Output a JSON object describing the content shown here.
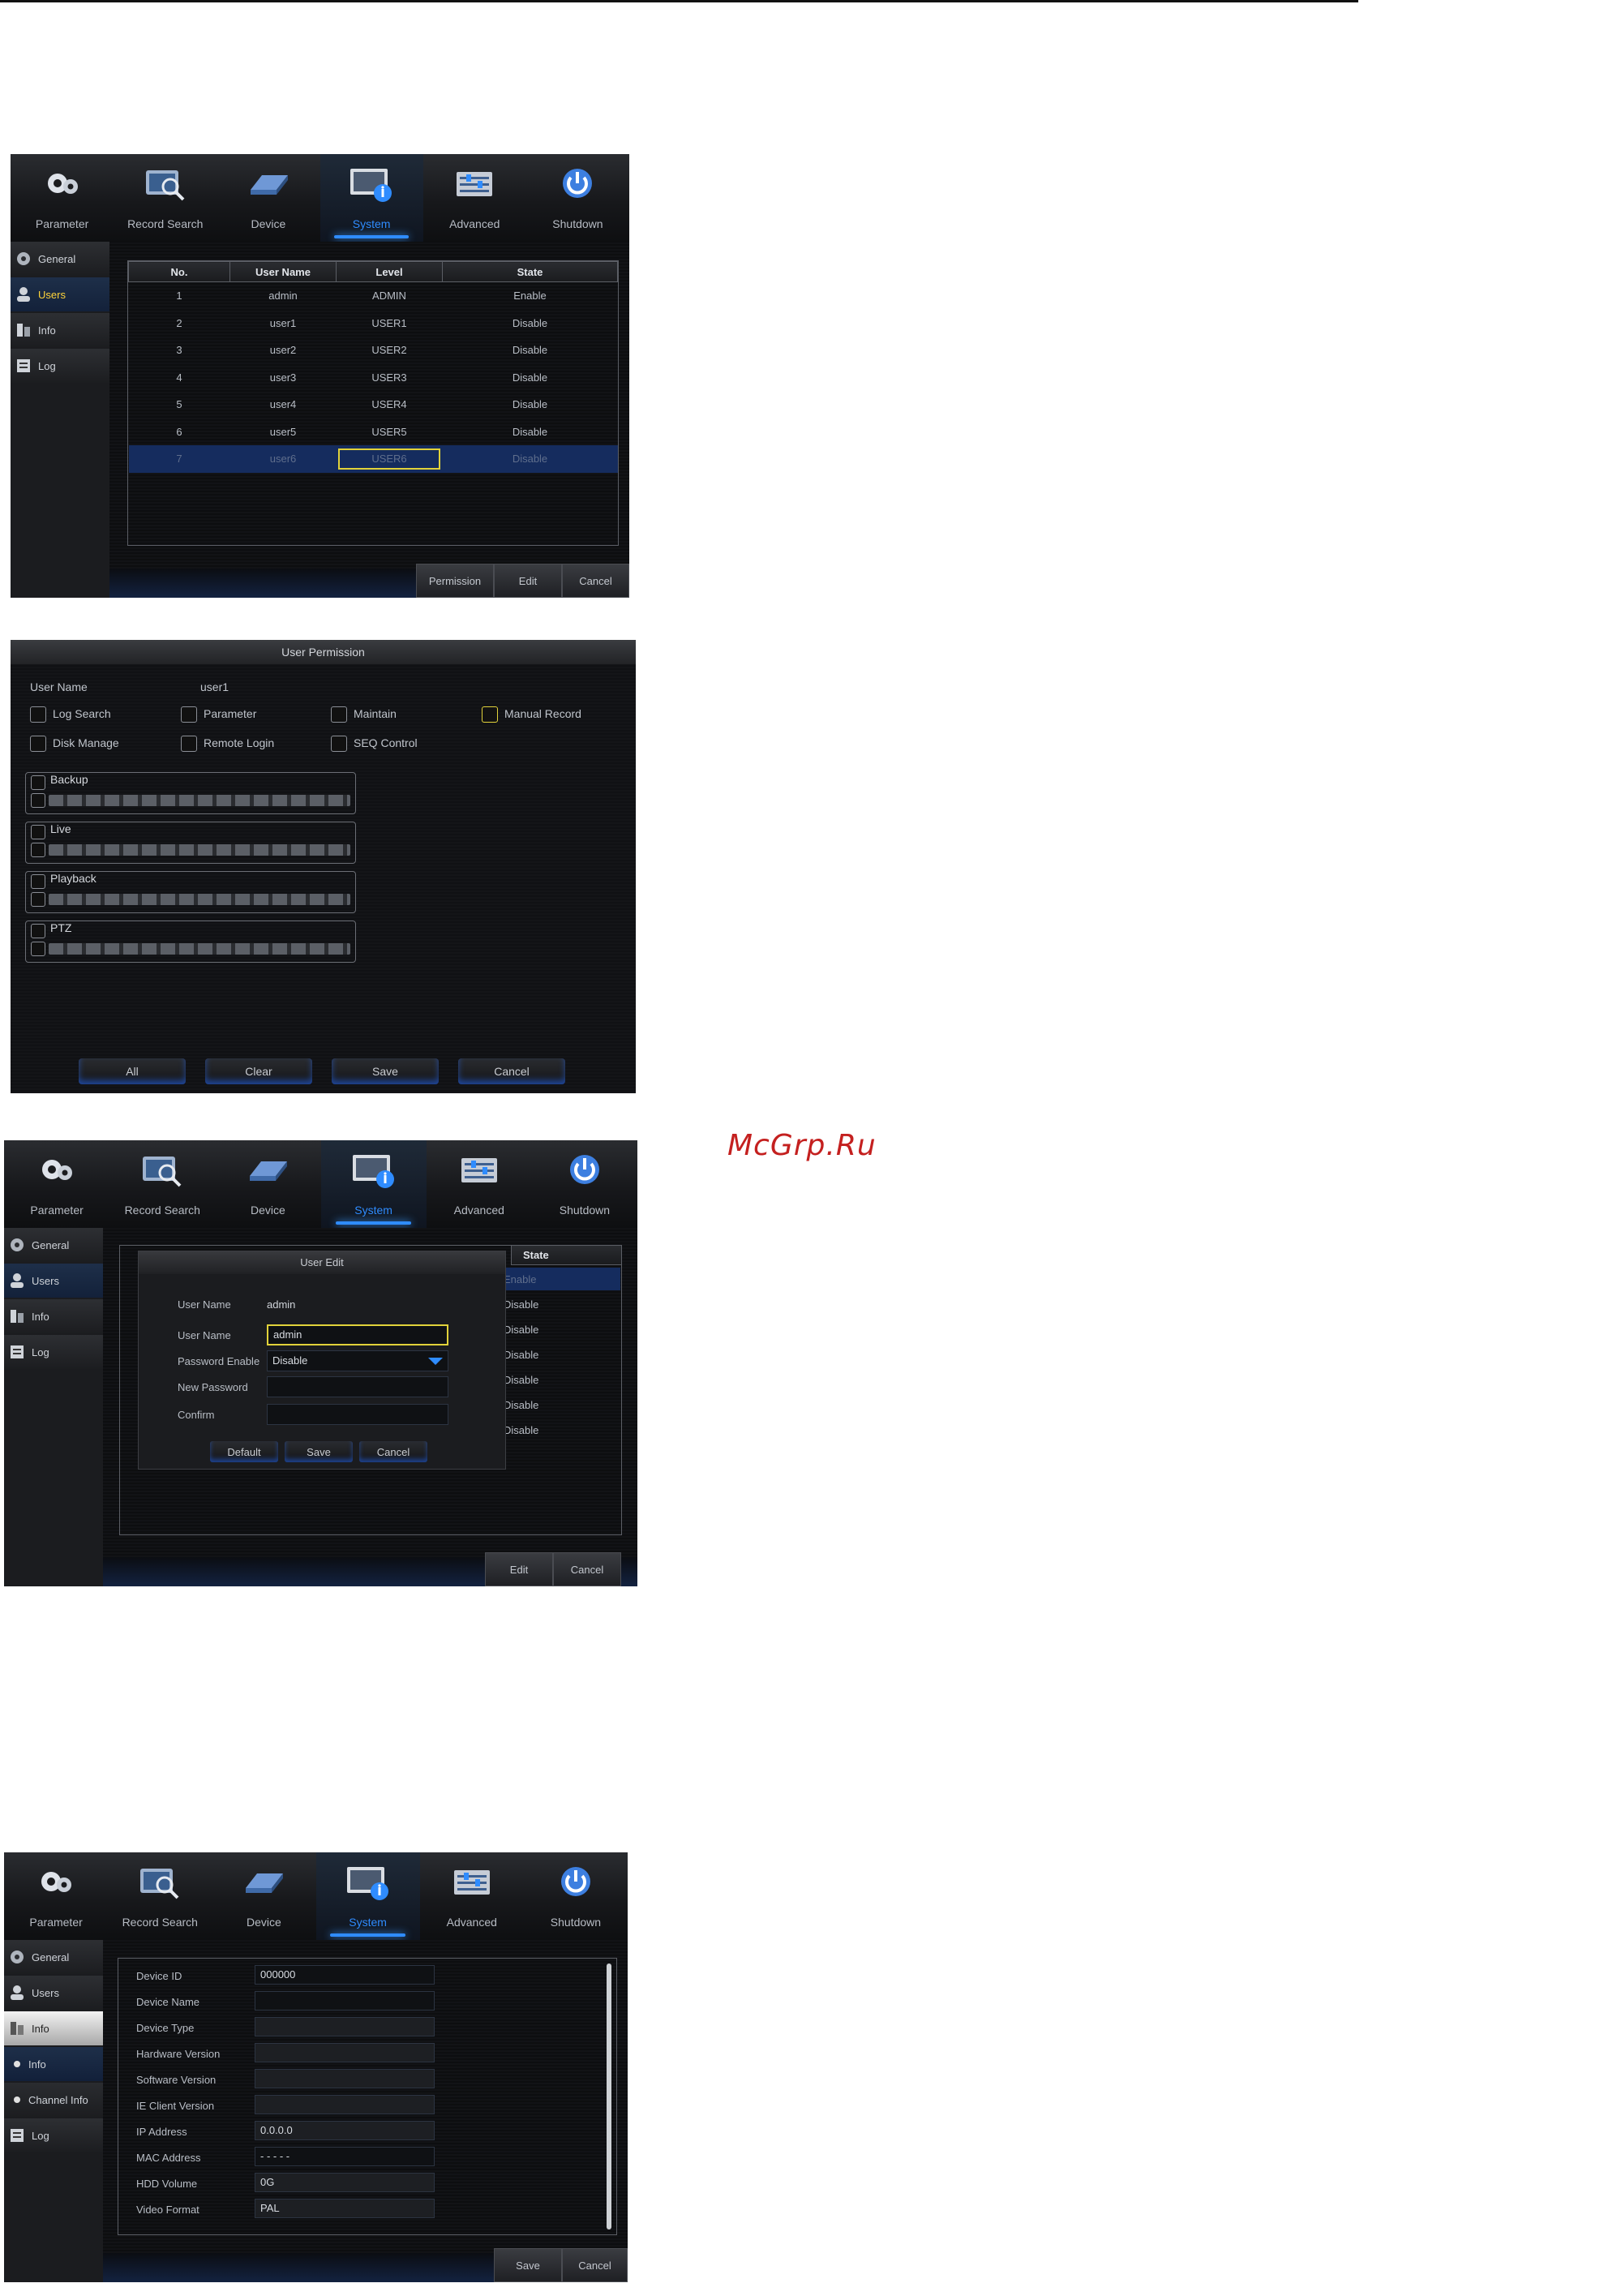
{
  "watermark": "McGrp.Ru",
  "nav": [
    "Parameter",
    "Record Search",
    "Device",
    "System",
    "Advanced",
    "Shutdown"
  ],
  "sidebar": {
    "general": "General",
    "users": "Users",
    "info": "Info",
    "log": "Log",
    "channel_info": "Channel Info"
  },
  "users_table": {
    "headers": [
      "No.",
      "User Name",
      "Level",
      "State"
    ],
    "rows": [
      [
        "1",
        "admin",
        "ADMIN",
        "Enable"
      ],
      [
        "2",
        "user1",
        "USER1",
        "Disable"
      ],
      [
        "3",
        "user2",
        "USER2",
        "Disable"
      ],
      [
        "4",
        "user3",
        "USER3",
        "Disable"
      ],
      [
        "5",
        "user4",
        "USER4",
        "Disable"
      ],
      [
        "6",
        "user5",
        "USER5",
        "Disable"
      ],
      [
        "7",
        "user6",
        "USER6",
        "Disable"
      ]
    ]
  },
  "users_buttons": {
    "permission": "Permission",
    "edit": "Edit",
    "cancel": "Cancel"
  },
  "permission": {
    "title": "User Permission",
    "user_name_label": "User Name",
    "user_name": "user1",
    "options": [
      "Log Search",
      "Parameter",
      "Maintain",
      "Manual Record",
      "Disk Manage",
      "Remote Login",
      "SEQ Control"
    ],
    "groups": [
      "Backup",
      "Live",
      "Playback",
      "PTZ"
    ],
    "buttons": {
      "all": "All",
      "clear": "Clear",
      "save": "Save",
      "cancel": "Cancel"
    }
  },
  "user_edit": {
    "title": "User Edit",
    "state_header": "State",
    "states": [
      "Enable",
      "Disable",
      "Disable",
      "Disable",
      "Disable",
      "Disable",
      "Disable"
    ],
    "labels": {
      "user_name_ro": "User Name",
      "user_name": "User Name",
      "password_enable": "Password Enable",
      "new_password": "New Password",
      "confirm": "Confirm"
    },
    "values": {
      "user_name_ro": "admin",
      "user_name": "admin",
      "password_enable": "Disable",
      "new_password": "",
      "confirm": ""
    },
    "buttons": {
      "default": "Default",
      "save": "Save",
      "cancel": "Cancel"
    },
    "outer_buttons": {
      "edit": "Edit",
      "cancel": "Cancel"
    }
  },
  "info": {
    "fields": [
      {
        "label": "Device ID",
        "value": "000000"
      },
      {
        "label": "Device Name",
        "value": ""
      },
      {
        "label": "Device Type",
        "value": ""
      },
      {
        "label": "Hardware Version",
        "value": ""
      },
      {
        "label": "Software Version",
        "value": ""
      },
      {
        "label": "IE Client Version",
        "value": ""
      },
      {
        "label": "IP Address",
        "value": "0.0.0.0"
      },
      {
        "label": "MAC Address",
        "value": "- - - - -"
      },
      {
        "label": "HDD Volume",
        "value": "0G"
      },
      {
        "label": "Video Format",
        "value": "PAL"
      }
    ],
    "buttons": {
      "save": "Save",
      "cancel": "Cancel"
    }
  }
}
